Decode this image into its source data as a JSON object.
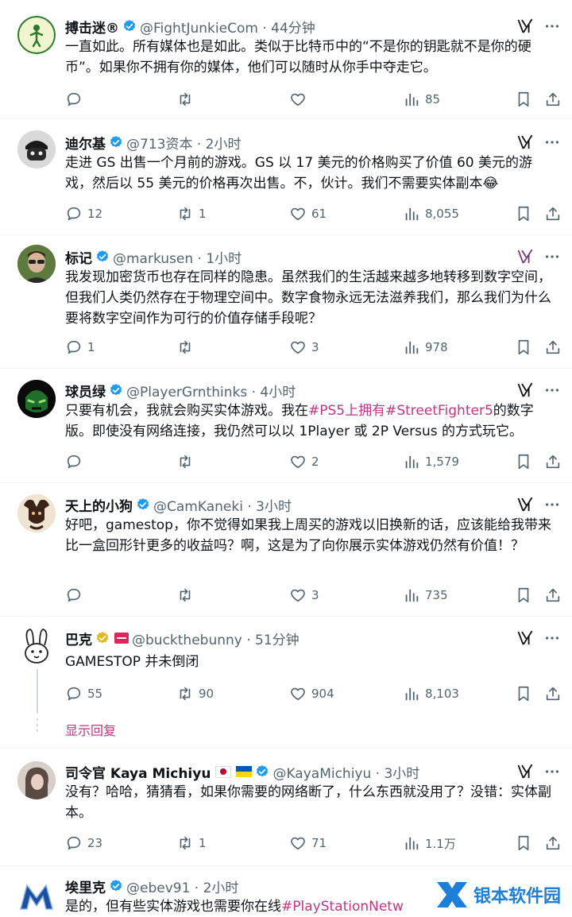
{
  "tweets": [
    {
      "name": "搏击迷®",
      "handle": "@FightJunkieCom · 44分钟",
      "text": "一直如此。所有媒体也是如此。类似于比特币中的“不是你的钥匙就不是你的硬币”。如果你不拥有你的媒体，他们可以随时从你手中夺走它。",
      "replies": "",
      "retweets": "",
      "likes": "",
      "views": "85"
    },
    {
      "name": "迪尔基",
      "handle": "@713资本 · 2小时",
      "text": "走进 GS 出售一个月前的游戏。GS 以 17 美元的价格购买了价值 60 美元的游戏，然后以 55 美元的价格再次出售。不，伙计。我们不需要实体副本😂",
      "replies": "12",
      "retweets": "1",
      "likes": "61",
      "views": "8,055"
    },
    {
      "name": "标记",
      "handle": "@markusen · 1小时",
      "text": "我发现加密货币也存在同样的隐患。虽然我们的生活越来越多地转移到数字空间，但我们人类仍然存在于物理空间中。数字食物永远无法滋养我们，那么我们为什么要将数字空间作为可行的价值存储手段呢？",
      "replies": "1",
      "retweets": "",
      "likes": "3",
      "views": "978"
    },
    {
      "name": "球员绿",
      "handle": "@PlayerGrnthinks · 4小时",
      "text_pre": "只要有机会，我就会购买实体游戏。我在",
      "text_tag": "#PS5上拥有#StreetFighter5",
      "text_post": "的数字版。即使没有网络连接，我仍然可以以 1Player 或 2P Versus 的方式玩它。",
      "replies": "",
      "retweets": "",
      "likes": "2",
      "views": "1,579"
    },
    {
      "name": "天上的小狗",
      "handle": "@CamKaneki · 3小时",
      "text": "好吧，gamestop，你不觉得如果我上周买的游戏以旧换新的话，应该能给我带来比一盒回形针更多的收益吗？啊，这是为了向你展示实体游戏仍然有价值！？",
      "replies": "",
      "retweets": "",
      "likes": "3",
      "views": "735"
    },
    {
      "name": "巴克",
      "handle": "@buckthebunny · 51分钟",
      "text": "GAMESTOP 并未倒闭",
      "replies": "55",
      "retweets": "90",
      "likes": "904",
      "views": "8,103",
      "show_replies": "显示回复"
    },
    {
      "name": "司令官 Kaya Michiyu",
      "handle": "@KayaMichiyu · 3小时",
      "text": "没有？哈哈，猜猜看，如果你需要的网络断了，什么东西就没用了？没错：实体副本。",
      "replies": "23",
      "retweets": "1",
      "likes": "71",
      "views": "1.1万"
    },
    {
      "name": "埃里克",
      "handle": "@ebev91 · 2小时",
      "text_pre": "是的，但有些实体游戏也需要你在线",
      "text_tag": "#PlayStationNetw"
    }
  ],
  "watermark": {
    "label": "银本软件园"
  },
  "colors": {
    "accent": "#c13584",
    "muted": "#536471",
    "verified": "#1d9bf0"
  }
}
